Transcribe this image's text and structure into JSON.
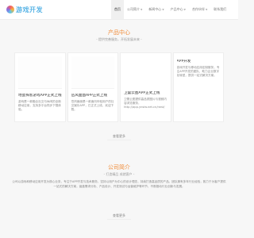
{
  "header": {
    "logo_text": "游戏开发",
    "nav": [
      {
        "label": "首页",
        "active": true,
        "has_caret": false
      },
      {
        "label": "公司简介",
        "active": false,
        "has_caret": true
      },
      {
        "label": "新闻中心",
        "active": false,
        "has_caret": true
      },
      {
        "label": "产品中心",
        "active": false,
        "has_caret": true
      },
      {
        "label": "合作伙伴",
        "active": false,
        "has_caret": true
      },
      {
        "label": "联系我们",
        "active": false,
        "has_caret": false
      }
    ]
  },
  "products": {
    "title": "产品中心",
    "subtitle": "- 提供完善服务，开拓发展未来 -",
    "cards": [
      {
        "title": "地蛋探客游戏APP正式上线",
        "desc": "游戏是一款融合社交与休闲的全新移动应用，支持多平台同步下载体验。"
      },
      {
        "title": "岳风面面APP正式上线",
        "desc": "岳风面面是一款面向年轻用户的社交娱乐APP，已正式上线，欢迎下载。"
      },
      {
        "title": "卫蕾云图APP正式上线",
        "desc": "卫蕾云图提供高品质图片与视频内容浏览服务，http://app.ynsiw.net.cn/rwst/"
      },
      {
        "title": "APP开发",
        "desc": "游戏开发与移动应用定制服务，专注APP开发的团队，助力企业数字化转型，提供一站式解决方案。"
      }
    ],
    "more_label": "查看更多"
  },
  "about": {
    "title": "公司简介",
    "subtitle": "- 打造精品 成就客户 -",
    "text": "公司以游戏和移动应用开发为核心业务，专注于APP开发与技术服务，坚持以用户为中心的设计理念，持续打造高品质的产品。团队拥有多年行业经验，致力于为客户提供一站式的解决方案，涵盖需求分析、产品设计、开发测试与运营维护等环节，不断推动行业创新与发展。",
    "more_label": "查看更多"
  }
}
